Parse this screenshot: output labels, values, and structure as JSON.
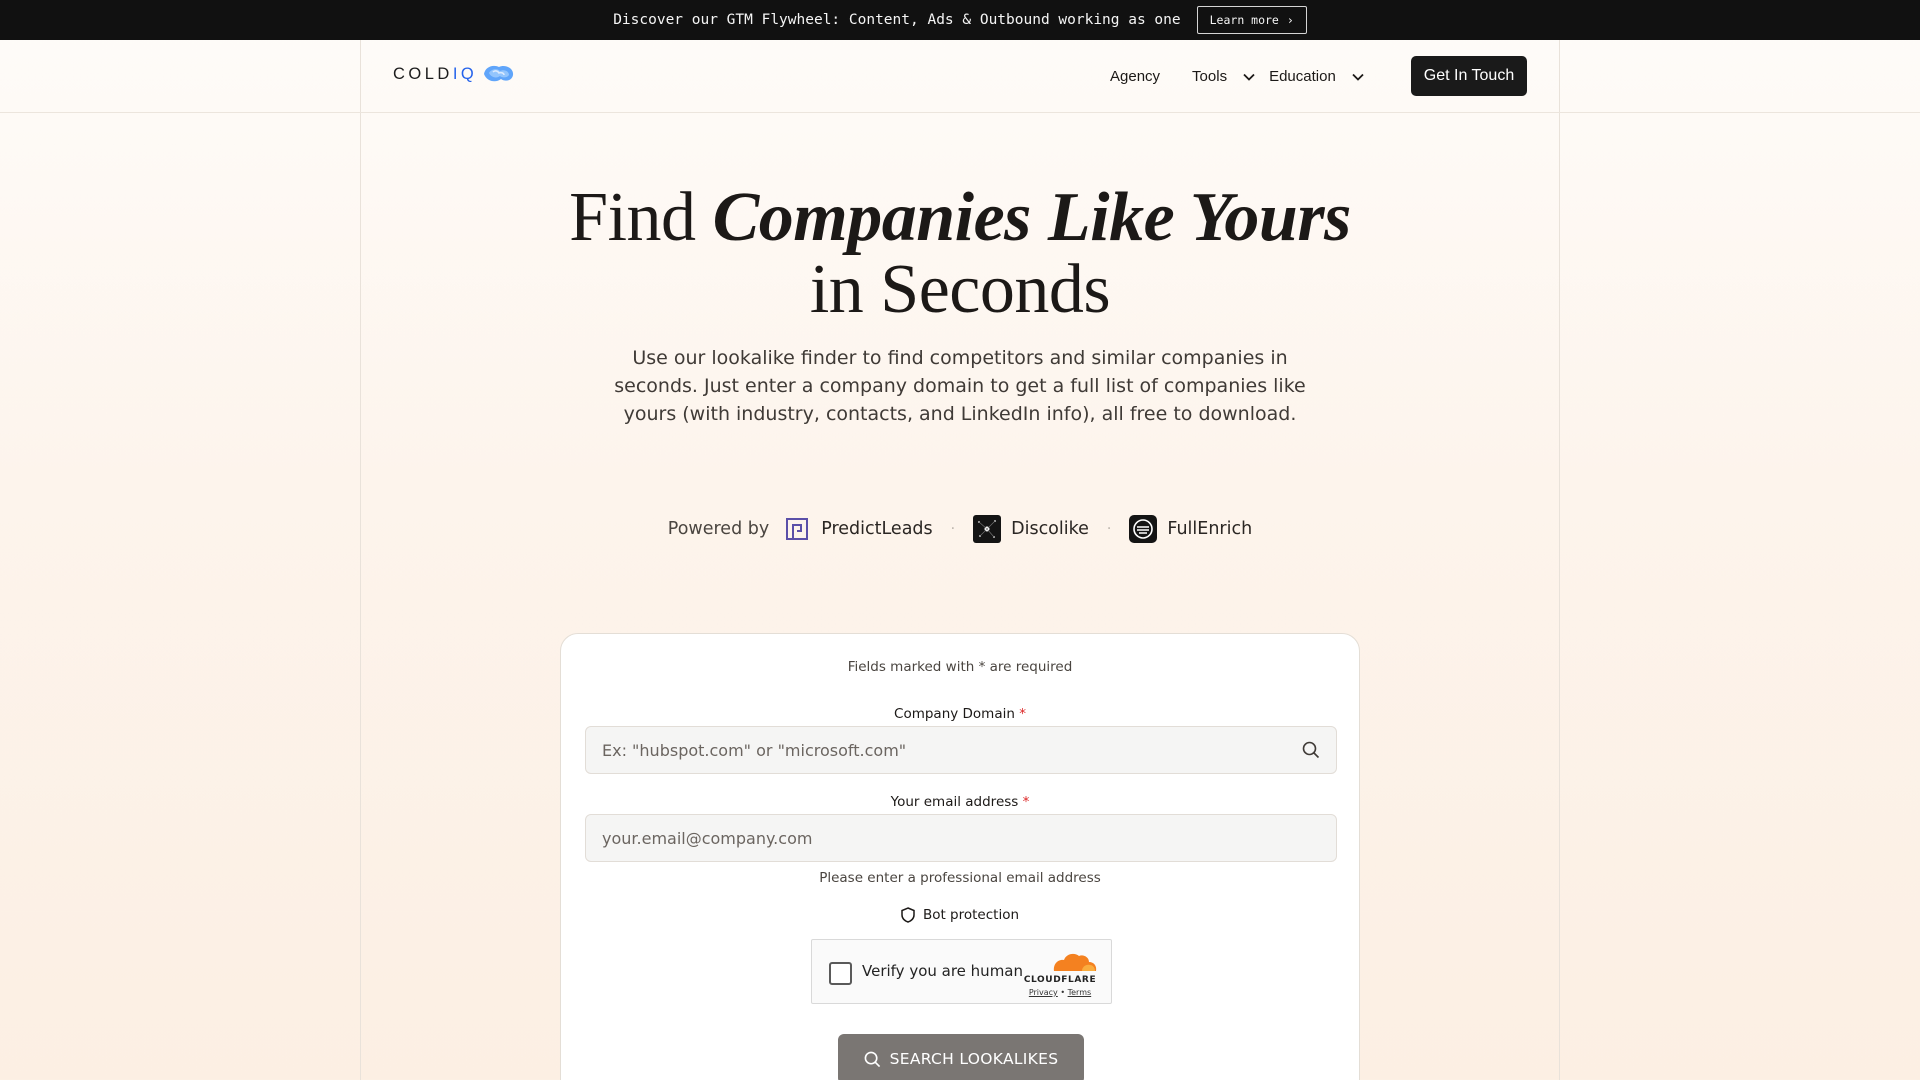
{
  "announcement": {
    "text": "Discover our GTM Flywheel: Content, Ads & Outbound working as one",
    "button_label": "Learn more"
  },
  "nav": {
    "logo_cold": "COLD",
    "logo_iq": "IQ",
    "links": [
      {
        "label": "Agency",
        "dropdown": false
      },
      {
        "label": "Tools",
        "dropdown": true
      },
      {
        "label": "Education",
        "dropdown": true
      }
    ],
    "cta_label": "Get In Touch"
  },
  "hero": {
    "title_plain": "Find ",
    "title_emphasis": "Companies Like Yours",
    "title_line2": "in Seconds",
    "subtitle": "Use our lookalike finder to find competitors and similar companies in seconds. Just enter a company domain to get a full list of companies like yours (with industry, contacts, and LinkedIn info), all free to download."
  },
  "powered": {
    "label": "Powered by",
    "providers": [
      {
        "name": "PredictLeads",
        "icon": "predictleads-icon"
      },
      {
        "name": "Discolike",
        "icon": "discolike-icon"
      },
      {
        "name": "FullEnrich",
        "icon": "fullenrich-icon"
      }
    ],
    "separator": "·"
  },
  "form": {
    "required_note": "Fields marked with * are required",
    "domain_label": "Company Domain",
    "domain_placeholder": "Ex: \"hubspot.com\" or \"microsoft.com\"",
    "email_label": "Your email address",
    "email_placeholder": "your.email@company.com",
    "email_hint": "Please enter a professional email address",
    "required_mark": "*",
    "bot_label": "Bot protection",
    "captcha": {
      "label": "Verify you are human",
      "brand": "CLOUDFLARE",
      "privacy": "Privacy",
      "dot": "•",
      "terms": "Terms"
    },
    "submit_label": "SEARCH LOOKALIKES"
  },
  "colors": {
    "accent_blue": "#2563eb",
    "required_red": "#dc2626",
    "cta_dark": "#1a1a1a",
    "submit_gray": "#7a7673",
    "cloudflare_orange": "#f48120"
  }
}
